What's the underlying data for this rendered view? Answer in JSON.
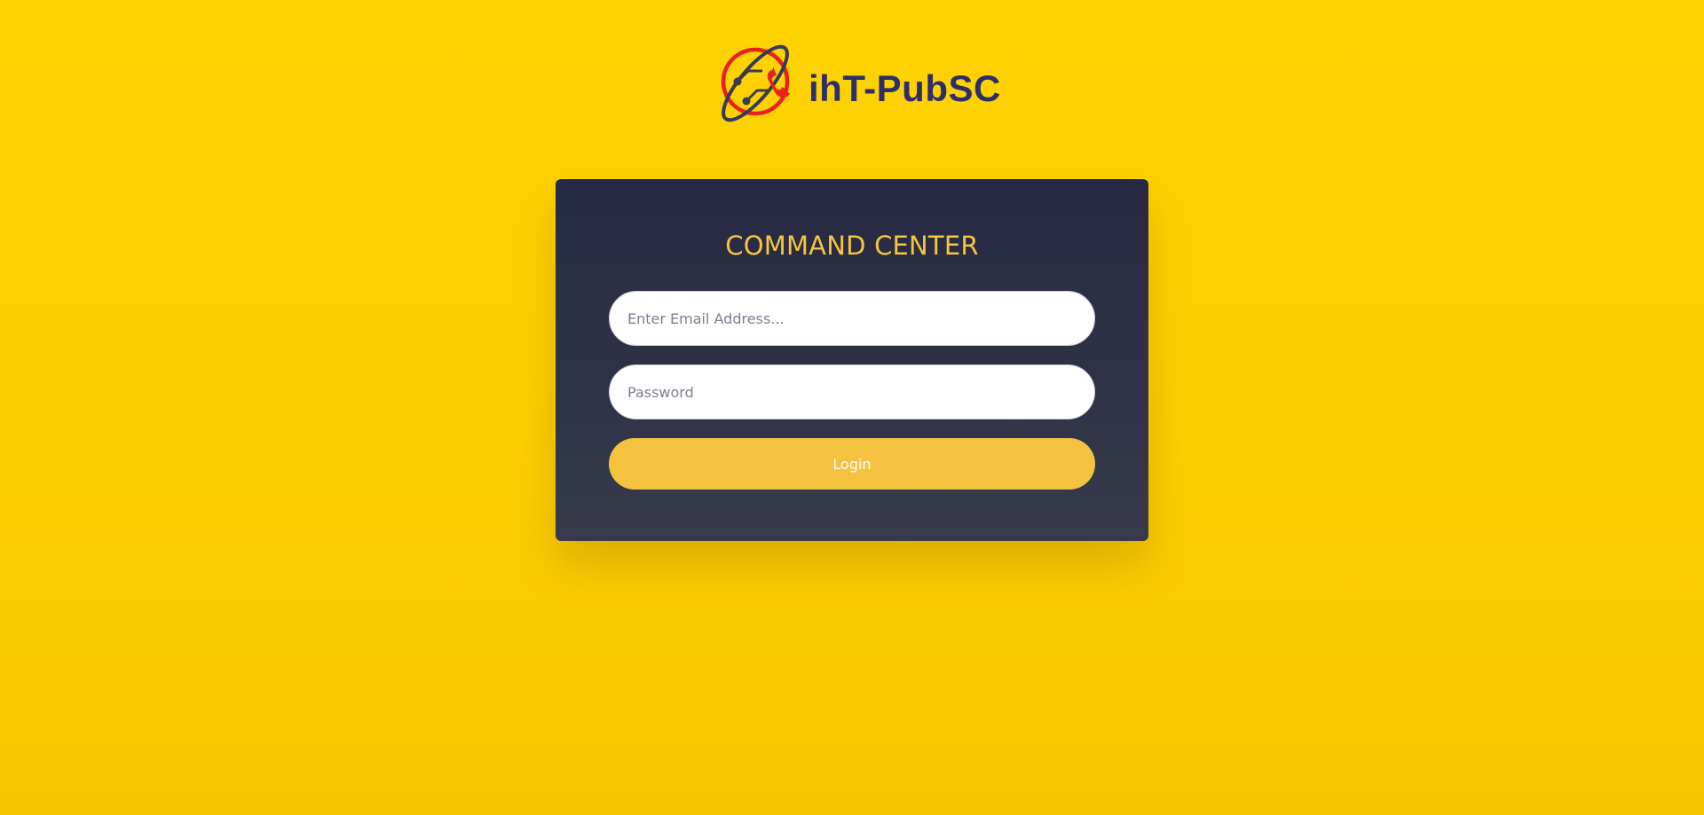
{
  "brand": {
    "name": "ihT-PubSC",
    "logo_icon": "phone-orbit-logo-icon",
    "name_color": "#2e2e6b",
    "logo_accent": "#e8201e"
  },
  "login": {
    "title": "COMMAND CENTER",
    "email_placeholder": "Enter Email Address...",
    "password_placeholder": "Password",
    "login_label": "Login"
  },
  "colors": {
    "background": "#ffd302",
    "card": "#2a2d44",
    "accent": "#f5c240",
    "title": "#f6c63b"
  }
}
